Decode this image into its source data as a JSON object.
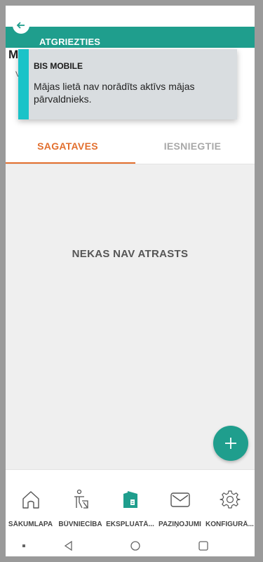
{
  "header": {
    "back_label": "ATGRIEZTIES"
  },
  "page": {
    "title_partial": "M",
    "subtitle_partial": "V"
  },
  "toast": {
    "title": "BIS MOBILE",
    "message": "Mājas lietā nav norādīts aktīvs mājas pārvaldnieks."
  },
  "tabs": [
    {
      "label": "SAGATAVES",
      "active": true
    },
    {
      "label": "IESNIEGTIE",
      "active": false
    }
  ],
  "empty_state": {
    "message": "NEKAS NAV ATRASTS"
  },
  "bottom_nav": [
    {
      "label": "SĀKUMLAPA",
      "icon": "home-icon"
    },
    {
      "label": "BŪVNIECĪBA",
      "icon": "worker-icon"
    },
    {
      "label": "EKSPLUATĀ...",
      "icon": "buildings-icon",
      "active": true
    },
    {
      "label": "PAZIŅOJUMI",
      "icon": "envelope-icon"
    },
    {
      "label": "KONFIGURĀ...",
      "icon": "gear-icon"
    }
  ],
  "colors": {
    "accent_teal": "#1f9e8d",
    "tab_active": "#e26f2e",
    "toast_bar": "#1ac3c8",
    "toast_bg": "#d9dde0"
  }
}
